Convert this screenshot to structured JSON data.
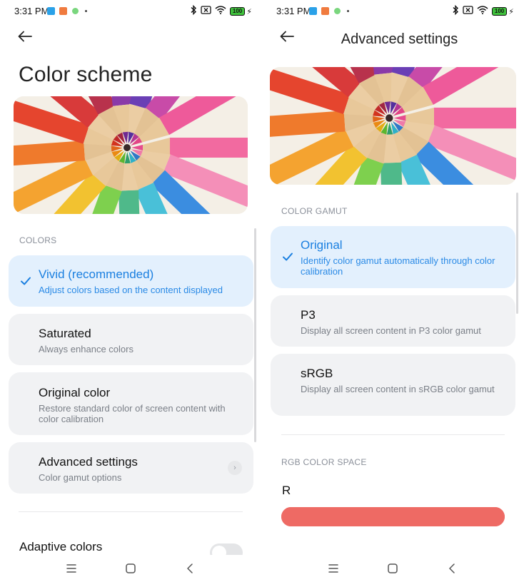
{
  "status_bar": {
    "time": "3:31 PM",
    "battery": "100"
  },
  "colors": {
    "accent": "#1a7fe0",
    "selected_card_bg": "#e3f0fd",
    "card_bg": "#f1f2f4",
    "slider_red": "#ee6a64"
  },
  "left": {
    "title": "Color scheme",
    "colors_section_label": "COLORS",
    "options": [
      {
        "title": "Vivid (recommended)",
        "subtitle": "Adjust colors based on the content displayed",
        "selected": true
      },
      {
        "title": "Saturated",
        "subtitle": "Always enhance colors",
        "selected": false
      },
      {
        "title": "Original color",
        "subtitle": "Restore standard color of screen content with color calibration",
        "selected": false
      }
    ],
    "advanced": {
      "title": "Advanced settings",
      "subtitle": "Color gamut options"
    },
    "adaptive": {
      "title": "Adaptive colors",
      "enabled": false
    }
  },
  "right": {
    "title": "Advanced settings",
    "gamut_section_label": "COLOR GAMUT",
    "options": [
      {
        "title": "Original",
        "subtitle": "Identify color gamut automatically through color calibration",
        "selected": true
      },
      {
        "title": "P3",
        "subtitle": "Display all screen content in P3 color gamut",
        "selected": false
      },
      {
        "title": "sRGB",
        "subtitle": "Display all screen content in sRGB color gamut",
        "selected": false
      }
    ],
    "rgb_section_label": "RGB COLOR SPACE",
    "r_label": "R",
    "r_value_fraction": 1.0
  },
  "icons": {
    "back": "arrow-left-icon",
    "check": "check-icon",
    "chevron": "chevron-right-icon",
    "nav_menu": "menu-icon",
    "nav_home": "home-icon",
    "nav_back": "back-icon",
    "bluetooth": "bluetooth-icon",
    "wifi": "wifi-icon"
  }
}
